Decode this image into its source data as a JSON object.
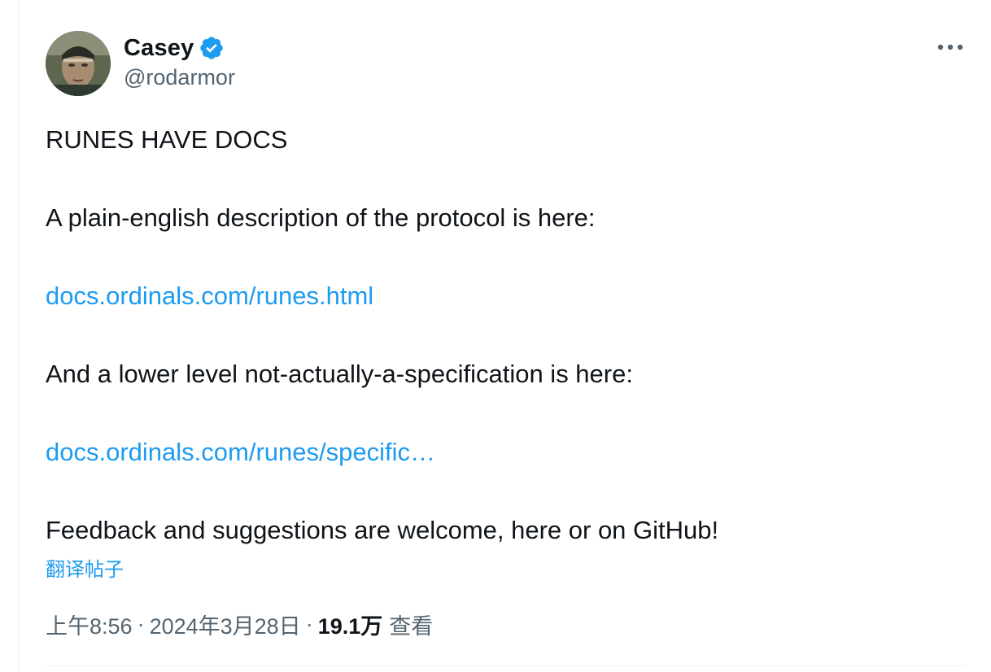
{
  "author": {
    "display_name": "Casey",
    "handle": "@rodarmor",
    "verified": true
  },
  "colors": {
    "link": "#1d9bf0",
    "text": "#0f1419",
    "secondary": "#536471",
    "verified_badge": "#1d9bf0"
  },
  "icons": {
    "more": "more-horizontal-icon",
    "verified": "verified-badge-icon"
  },
  "tweet": {
    "line1": "RUNES HAVE DOCS",
    "line2": "A plain-english description of the protocol is here:",
    "link1": "docs.ordinals.com/runes.html",
    "line3": "And a lower level not-actually-a-specification is here:",
    "link2": "docs.ordinals.com/runes/specific…",
    "line4": "Feedback and suggestions are welcome, here or on GitHub!"
  },
  "translate_label": "翻译帖子",
  "meta": {
    "time": "上午8:56",
    "separator": "·",
    "date": "2024年3月28日",
    "views_count": "19.1万",
    "views_label": "查看"
  }
}
